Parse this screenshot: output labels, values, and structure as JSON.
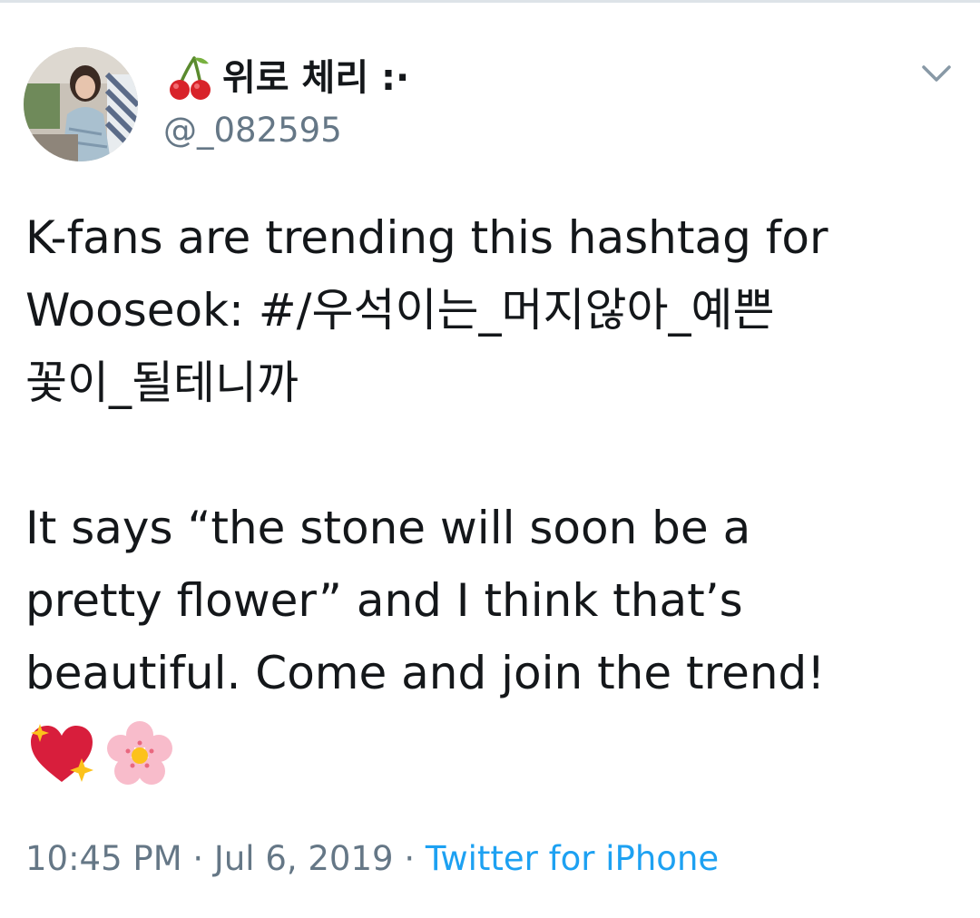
{
  "tweet": {
    "author": {
      "display_name": "위로 체리 :·",
      "name_emoji": "cherries-icon",
      "handle": "@_082595",
      "avatar": "avatar"
    },
    "menu_icon": "chevron-down-icon",
    "text_lines": [
      "K-fans are trending this hashtag for",
      "Wooseok: #/우석이는_머지않아_예쁜",
      "꽃이_될테니까",
      "",
      "It says “the stone will soon be a",
      "pretty flower” and I think that’s",
      "beautiful. Come and join the trend!"
    ],
    "emojis": [
      "sparkling-heart-icon",
      "cherry-blossom-icon"
    ],
    "meta": {
      "time": "10:45 PM",
      "separator": "·",
      "date": "Jul 6, 2019",
      "source": "Twitter for iPhone"
    }
  },
  "colors": {
    "text": "#14171a",
    "secondary": "#657786",
    "link": "#1da1f2"
  }
}
